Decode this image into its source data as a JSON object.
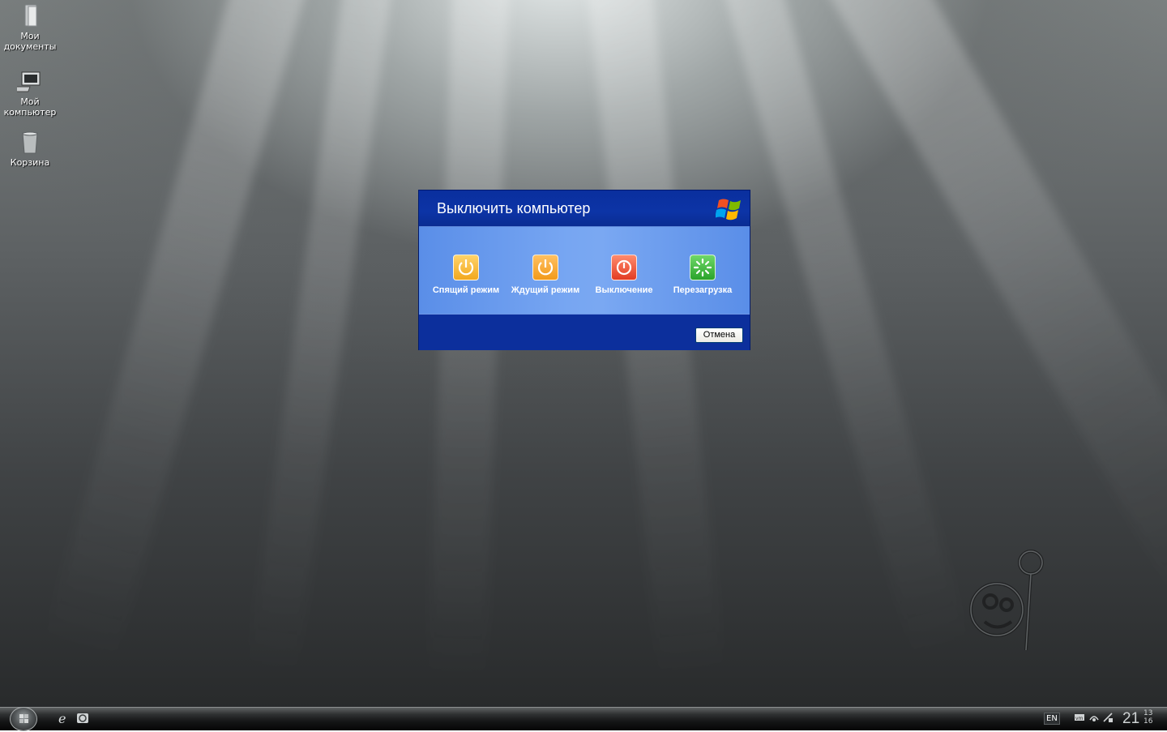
{
  "desktop": {
    "icons": [
      {
        "label": "Мои\nдокументы",
        "icon": "folder-documents-icon"
      },
      {
        "label": "Мой\nкомпьютер",
        "icon": "my-computer-icon"
      },
      {
        "label": "Корзина",
        "icon": "recycle-bin-icon"
      }
    ]
  },
  "dialog": {
    "title": "Выключить компьютер",
    "options": [
      {
        "label": "Спящий режим",
        "icon": "power-icon",
        "color": "#f2a81e"
      },
      {
        "label": "Ждущий режим",
        "icon": "power-icon",
        "color": "#f29a1a"
      },
      {
        "label": "Выключение",
        "icon": "shutdown-icon",
        "color": "#e23c24"
      },
      {
        "label": "Перезагрузка",
        "icon": "restart-icon",
        "color": "#2aa32a"
      }
    ],
    "cancel_label": "Отмена"
  },
  "taskbar": {
    "quick_launch": [
      "internet-explorer-icon",
      "outlook-express-icon"
    ],
    "language": "EN",
    "tray": [
      "vmware-icon",
      "network-icon",
      "network-status-icon"
    ],
    "clock": {
      "hm": "21",
      "seconds_top": "13",
      "seconds_bottom": "16"
    }
  },
  "colors": {
    "dialog_header": "#0c34a6",
    "dialog_body": "#77a6f2",
    "dialog_footer": "#0c2f9c"
  }
}
